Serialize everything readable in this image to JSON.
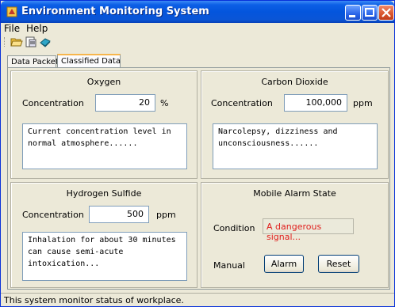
{
  "window": {
    "title": "Environment Monitoring System"
  },
  "menu": {
    "file": "File",
    "help": "Help"
  },
  "tabs": [
    {
      "label": "Data Packet"
    },
    {
      "label": "Classified Data",
      "selected": true
    }
  ],
  "panels": {
    "oxygen": {
      "title": "Oxygen",
      "concentration_label": "Concentration",
      "value": "20",
      "unit": "%",
      "description": "Current concentration level in\nnormal atmosphere......"
    },
    "co2": {
      "title": "Carbon Dioxide",
      "concentration_label": "Concentration",
      "value": "100,000",
      "unit": "ppm",
      "description": "Narcolepsy, dizziness and\nunconsciousness......"
    },
    "h2s": {
      "title": "Hydrogen Sulfide",
      "concentration_label": "Concentration",
      "value": "500",
      "unit": "ppm",
      "description": "Inhalation for about 30 minutes\ncan cause semi-acute intoxication..."
    },
    "alarm": {
      "title": "Mobile Alarm State",
      "condition_label": "Condition",
      "condition_value": "A dangerous signal...",
      "manual_label": "Manual",
      "alarm_button": "Alarm",
      "reset_button": "Reset"
    }
  },
  "status": {
    "text": "This system monitor status of workplace."
  },
  "colors": {
    "title_bar": "#0455dd",
    "alert_text": "#e0201e",
    "active_tab_accent": "#f7b64c"
  },
  "icons": [
    "app-icon",
    "open-folder-icon",
    "save-document-icon",
    "book-icon"
  ]
}
